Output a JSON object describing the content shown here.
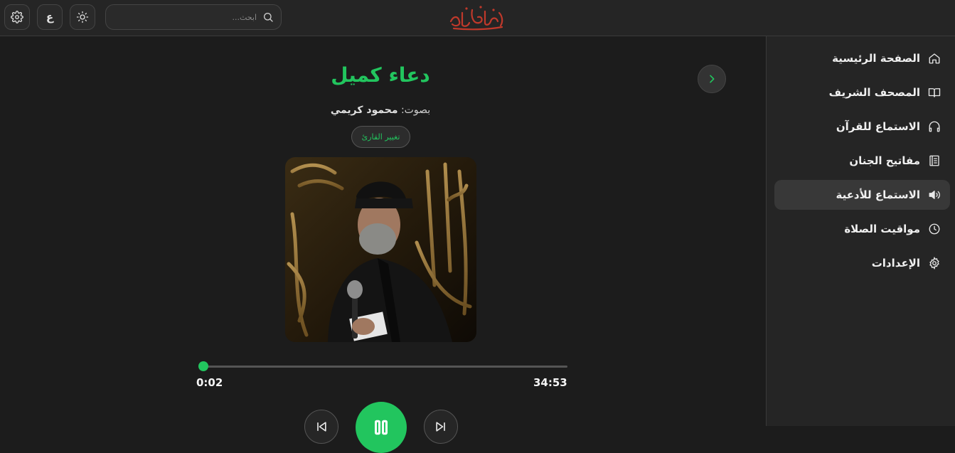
{
  "topbar": {
    "search_placeholder": "ابحث...",
    "language_label": "ع"
  },
  "sidebar": {
    "items": [
      {
        "label": "الصفحة الرئيسية",
        "icon": "home-icon",
        "active": false
      },
      {
        "label": "المصحف الشريف",
        "icon": "book-icon",
        "active": false
      },
      {
        "label": "الاستماع للقرآن",
        "icon": "headphones-icon",
        "active": false
      },
      {
        "label": "مفاتيح الجنان",
        "icon": "document-icon",
        "active": false
      },
      {
        "label": "الاستماع للأدعية",
        "icon": "speaker-icon",
        "active": true
      },
      {
        "label": "مواقيت الصلاة",
        "icon": "clock-icon",
        "active": false
      },
      {
        "label": "الإعدادات",
        "icon": "gear-icon",
        "active": false
      }
    ]
  },
  "player": {
    "title": "دعاء كميل",
    "reciter_prefix": "بصوت:",
    "reciter_name": "محمود كريمي",
    "change_reciter_label": "تغيير القارئ",
    "current_time": "0:02",
    "duration": "34:53",
    "progress_fraction": 0.001,
    "state": "playing"
  },
  "colors": {
    "accent": "#22c55e",
    "background": "#1c1c1c",
    "panel": "#252525",
    "logo": "#c0392b"
  }
}
